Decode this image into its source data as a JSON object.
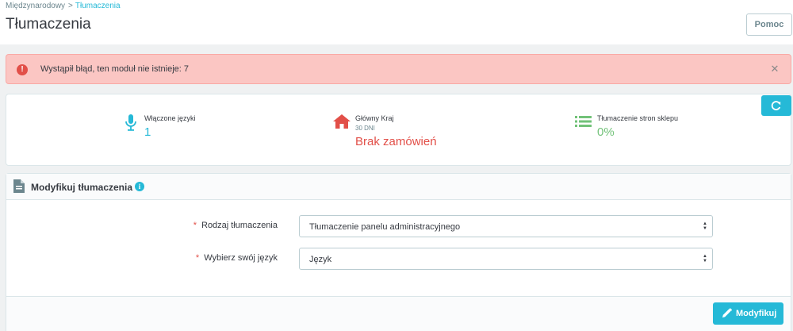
{
  "breadcrumb": {
    "parent": "Międzynarodowy",
    "separator": ">",
    "current": "Tłumaczenia"
  },
  "header": {
    "title": "Tłumaczenia",
    "help_label": "Pomoc"
  },
  "alert": {
    "message": "Wystąpił błąd, ten moduł nie istnieje: 7",
    "icon": "error-icon",
    "close_icon": "close-icon"
  },
  "kpis": [
    {
      "label": "Włączone języki",
      "sublabel": "",
      "value": "1",
      "icon": "microphone-icon",
      "color": "#25b9d7"
    },
    {
      "label": "Główny Kraj",
      "sublabel": "30 DNI",
      "value": "Brak zamówień",
      "icon": "home-icon",
      "color": "#e24f48"
    },
    {
      "label": "Tłumaczenie stron sklepu",
      "sublabel": "",
      "value": "0%",
      "icon": "list-icon",
      "color": "#72c279"
    }
  ],
  "refresh": {
    "icon": "refresh-icon"
  },
  "form": {
    "title": "Modyfikuj tłumaczenia",
    "fields": [
      {
        "label": "Rodzaj tłumaczenia",
        "required": "*",
        "value": "Tłumaczenie panelu administracyjnego"
      },
      {
        "label": "Wybierz swój język",
        "required": "*",
        "value": "Język"
      }
    ],
    "submit_label": "Modyfikuj"
  },
  "colors": {
    "accent": "#25b9d7",
    "danger": "#e24f48",
    "success": "#72c279",
    "alert_bg": "#fbc6c3"
  }
}
